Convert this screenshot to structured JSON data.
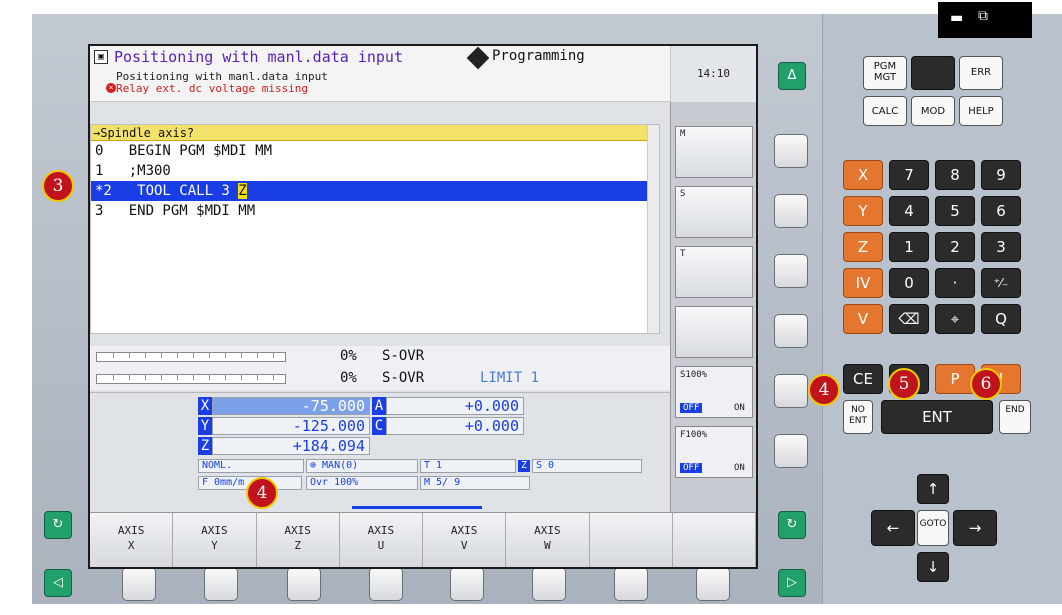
{
  "header": {
    "mode_title": "Positioning with manl.data input",
    "program_mode": "Programming",
    "sub_status": "Positioning with manl.data input",
    "error_message": "Relay ext. dc voltage missing",
    "clock": "14:10"
  },
  "editor": {
    "prompt": "→Spindle axis?",
    "lines": [
      "0   BEGIN PGM $MDI MM",
      "1   ;M300",
      "*2   TOOL CALL 3 ",
      "3   END PGM $MDI MM"
    ],
    "cursor_text": "Z"
  },
  "override": {
    "s_ovr_pct": "0%",
    "s_ovr_label": "S-OVR",
    "f_ovr_pct": "0%",
    "f_ovr_label": "S-OVR",
    "limit": "LIMIT 1"
  },
  "positions": {
    "x_label": "X",
    "x_value": "-75.000",
    "y_label": "Y",
    "y_value": "-125.000",
    "z_label": "Z",
    "z_value": "+184.094",
    "a_label": "A",
    "a_value": "+0.000",
    "c_label": "C",
    "c_value": "+0.000"
  },
  "status": {
    "noml": "NOML.",
    "man": "⊕ MAN(0)",
    "tool": "T 1",
    "spindle_axis": "Z",
    "spindle": "S    0",
    "feed": "F  0mm/m",
    "ovr": "Ovr  100%",
    "m": "M 5/ 9"
  },
  "side_status": {
    "s_pct": "S100%",
    "f_pct": "F100%",
    "off1": "OFF",
    "on1": "ON",
    "off2": "OFF",
    "on2": "ON",
    "m_label": "M",
    "s_label": "S",
    "t_label": "T"
  },
  "softkeys": [
    {
      "top": "AXIS",
      "bottom": "X"
    },
    {
      "top": "AXIS",
      "bottom": "Y"
    },
    {
      "top": "AXIS",
      "bottom": "Z"
    },
    {
      "top": "AXIS",
      "bottom": "U"
    },
    {
      "top": "AXIS",
      "bottom": "V"
    },
    {
      "top": "AXIS",
      "bottom": "W"
    },
    {
      "top": "",
      "bottom": ""
    },
    {
      "top": "",
      "bottom": ""
    }
  ],
  "keypad": {
    "pgm_mgt": "PGM MGT",
    "err": "ERR",
    "calc": "CALC",
    "mod": "MOD",
    "help": "HELP",
    "x": "X",
    "y": "Y",
    "z": "Z",
    "iv": "IV",
    "v": "V",
    "k7": "7",
    "k8": "8",
    "k9": "9",
    "k4": "4",
    "k5": "5",
    "k6": "6",
    "k1": "1",
    "k2": "2",
    "k3": "3",
    "k0": "0",
    "dot": "·",
    "sign": "⁺⁄₋",
    "q": "Q",
    "ce": "CE",
    "p": "P",
    "i": "I",
    "no_ent": "NO ENT",
    "ent": "ENT",
    "end": "END",
    "goto": "GOTO"
  },
  "buttons": {
    "delta": "Δ",
    "prev": "◁",
    "next": "▷",
    "cycle": "↻"
  },
  "callouts": [
    "3",
    "4",
    "5",
    "6",
    "4"
  ]
}
